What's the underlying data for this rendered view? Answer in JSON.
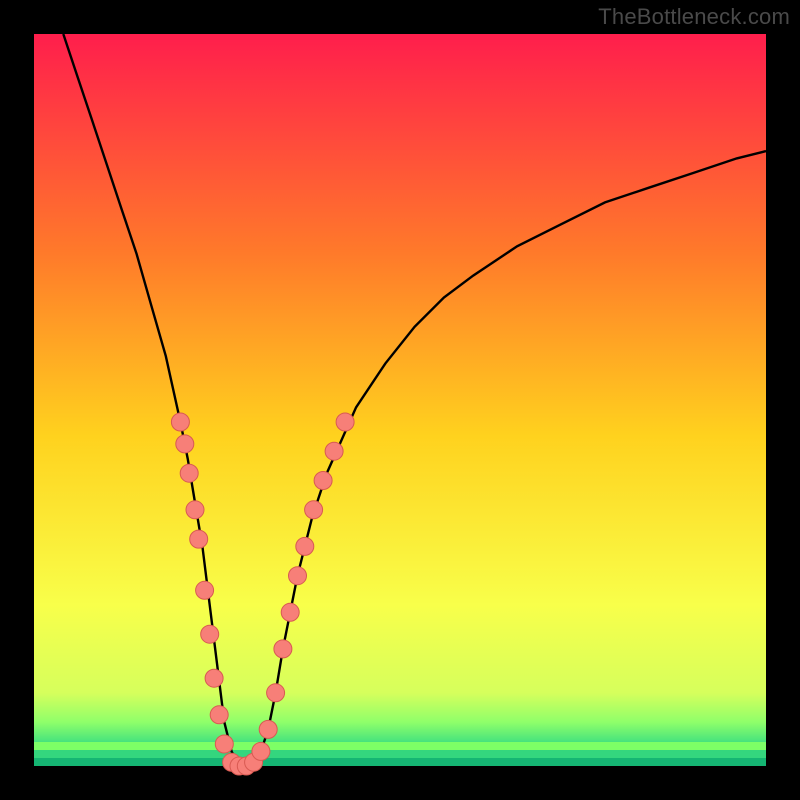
{
  "watermark": "TheBottleneck.com",
  "colors": {
    "gradient_top": "#ff1e4c",
    "gradient_mid1": "#ff7a2a",
    "gradient_mid2": "#ffd21e",
    "gradient_mid3": "#f8ff4a",
    "gradient_mid4": "#d6ff5c",
    "gradient_bottom_band1": "#8fff6a",
    "gradient_bottom_band2": "#3fe07f",
    "gradient_bottom_band3": "#1ac97a",
    "curve": "#000000",
    "dot_fill": "#f77f78",
    "dot_stroke": "#d85a52",
    "frame": "#000000"
  },
  "chart_data": {
    "type": "line",
    "title": "",
    "xlabel": "",
    "ylabel": "",
    "xlim": [
      0,
      100
    ],
    "ylim": [
      0,
      100
    ],
    "annotations": [],
    "series": [
      {
        "name": "bottleneck-curve",
        "x": [
          4,
          6,
          8,
          10,
          12,
          14,
          16,
          18,
          20,
          21,
          22,
          23,
          24,
          25,
          26,
          27,
          28,
          29,
          30,
          31,
          32,
          33,
          34,
          36,
          38,
          40,
          44,
          48,
          52,
          56,
          60,
          66,
          72,
          78,
          84,
          90,
          96,
          100
        ],
        "y": [
          100,
          94,
          88,
          82,
          76,
          70,
          63,
          56,
          47,
          42,
          36,
          30,
          22,
          14,
          6,
          2,
          0,
          0,
          0,
          2,
          5,
          10,
          16,
          26,
          34,
          40,
          49,
          55,
          60,
          64,
          67,
          71,
          74,
          77,
          79,
          81,
          83,
          84
        ]
      }
    ],
    "markers": {
      "name": "highlight-dots",
      "points": [
        {
          "x": 20.0,
          "y": 47
        },
        {
          "x": 20.6,
          "y": 44
        },
        {
          "x": 21.2,
          "y": 40
        },
        {
          "x": 22.0,
          "y": 35
        },
        {
          "x": 22.5,
          "y": 31
        },
        {
          "x": 23.3,
          "y": 24
        },
        {
          "x": 24.0,
          "y": 18
        },
        {
          "x": 24.6,
          "y": 12
        },
        {
          "x": 25.3,
          "y": 7
        },
        {
          "x": 26.0,
          "y": 3
        },
        {
          "x": 27.0,
          "y": 0.5
        },
        {
          "x": 28.0,
          "y": 0
        },
        {
          "x": 29.0,
          "y": 0
        },
        {
          "x": 30.0,
          "y": 0.5
        },
        {
          "x": 31.0,
          "y": 2
        },
        {
          "x": 32.0,
          "y": 5
        },
        {
          "x": 33.0,
          "y": 10
        },
        {
          "x": 34.0,
          "y": 16
        },
        {
          "x": 35.0,
          "y": 21
        },
        {
          "x": 36.0,
          "y": 26
        },
        {
          "x": 37.0,
          "y": 30
        },
        {
          "x": 38.2,
          "y": 35
        },
        {
          "x": 39.5,
          "y": 39
        },
        {
          "x": 41.0,
          "y": 43
        },
        {
          "x": 42.5,
          "y": 47
        }
      ]
    }
  }
}
